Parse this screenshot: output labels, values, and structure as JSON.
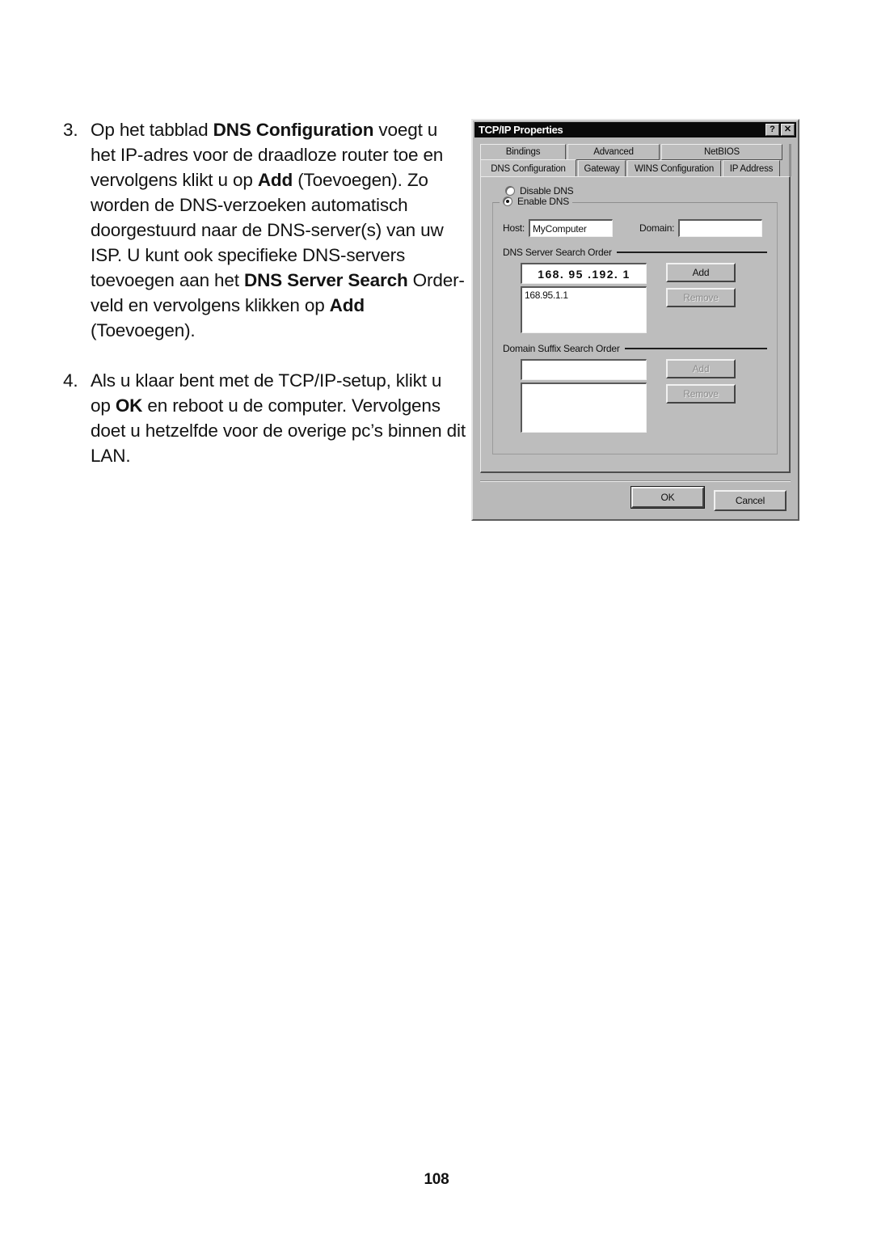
{
  "page": {
    "number": "108"
  },
  "instructions": [
    {
      "number": "3.",
      "segments": [
        {
          "text": "Op het tabblad ",
          "bold": false
        },
        {
          "text": "DNS Configuration",
          "bold": true
        },
        {
          "text": " voegt u het IP-adres voor de draadloze router toe en vervolgens klikt u op ",
          "bold": false
        },
        {
          "text": "Add",
          "bold": true
        },
        {
          "text": " (Toevoegen). Zo worden de DNS-verzoeken automatisch doorgestuurd naar de DNS-server(s) van uw ISP. U kunt ook specifieke DNS-servers toevoegen aan het ",
          "bold": false
        },
        {
          "text": "DNS Server Search",
          "bold": true
        },
        {
          "text": " Order-veld en vervolgens klikken op ",
          "bold": false
        },
        {
          "text": "Add",
          "bold": true
        },
        {
          "text": " (Toevoegen).",
          "bold": false
        }
      ]
    },
    {
      "number": "4.",
      "segments": [
        {
          "text": "Als u klaar bent met de TCP/IP-setup, klikt u op ",
          "bold": false
        },
        {
          "text": "OK",
          "bold": true
        },
        {
          "text": " en reboot u de computer. Vervolgens doet u hetzelfde voor de overige pc’s binnen dit LAN.",
          "bold": false
        }
      ]
    }
  ],
  "dialog": {
    "title": "TCP/IP Properties",
    "titlebar_buttons": [
      {
        "name": "help-button",
        "glyph": "?"
      },
      {
        "name": "close-button",
        "glyph": "✕"
      }
    ],
    "tabs_top": [
      {
        "label": "Bindings",
        "active": false
      },
      {
        "label": "Advanced",
        "active": false
      },
      {
        "label": "NetBIOS",
        "active": false
      }
    ],
    "tabs_bottom": [
      {
        "label": "DNS Configuration",
        "active": true
      },
      {
        "label": "Gateway",
        "active": false
      },
      {
        "label": "WINS Configuration",
        "active": false
      },
      {
        "label": "IP Address",
        "active": false
      }
    ],
    "radios": [
      {
        "label": "Disable DNS",
        "checked": false,
        "accel": "i"
      },
      {
        "label": "Enable DNS",
        "checked": true,
        "accel": "E"
      }
    ],
    "host_label": "Host:",
    "host_value": "MyComputer",
    "domain_label": "Domain:",
    "domain_value": "",
    "dns_search": {
      "section_label": "DNS Server Search Order",
      "input_value": "168. 95 .192.  1",
      "list_items": [
        "168.95.1.1"
      ],
      "add_label": "Add",
      "add_enabled": true,
      "remove_label": "Remove",
      "remove_enabled": false
    },
    "suffix_search": {
      "section_label": "Domain Suffix Search Order",
      "input_value": "",
      "list_items": [],
      "add_label": "Add",
      "add_enabled": false,
      "remove_label": "Remove",
      "remove_enabled": false
    },
    "footer_buttons": [
      {
        "label": "OK",
        "default": true
      },
      {
        "label": "Cancel",
        "default": false
      }
    ]
  },
  "colors": {
    "dialog_face": "#b9b9b9",
    "panel_face": "#bdbdbd",
    "titlebar": "#0a0a0a",
    "titlebar_text": "#ffffff",
    "field_bg": "#ffffff",
    "text": "#101010",
    "disabled_text": "#8d8d8d",
    "page_bg": "#ffffff"
  }
}
